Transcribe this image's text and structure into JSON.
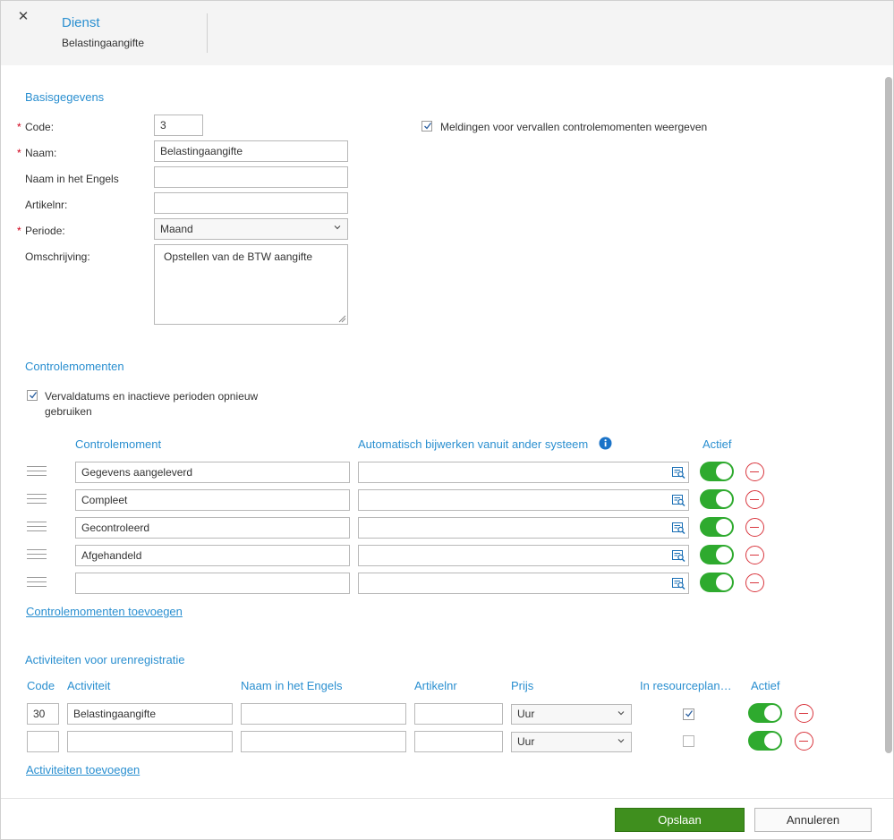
{
  "header": {
    "title": "Dienst",
    "subtitle": "Belastingaangifte",
    "close_icon": "close-icon"
  },
  "basis": {
    "section_title": "Basisgegevens",
    "code": {
      "label": "Code:",
      "value": "3",
      "required": true
    },
    "naam": {
      "label": "Naam:",
      "value": "Belastingaangifte",
      "required": true
    },
    "naam_engels": {
      "label": "Naam in het Engels",
      "value": ""
    },
    "artikelnr": {
      "label": "Artikelnr:",
      "value": ""
    },
    "periode": {
      "label": "Periode:",
      "value": "Maand",
      "required": true
    },
    "omschrijving": {
      "label": "Omschrijving:",
      "value": "Opstellen van de BTW aangifte"
    },
    "meldingen": {
      "label": "Meldingen voor vervallen controlemomenten weergeven",
      "checked": true
    }
  },
  "controle": {
    "section_title": "Controlemomenten",
    "reuse": {
      "label_line1": "Vervaldatums en inactieve perioden opnieuw",
      "label_line2": "gebruiken",
      "checked": true
    },
    "col_moment": "Controlemoment",
    "col_auto": "Automatisch bijwerken vanuit ander systeem",
    "col_actief": "Actief",
    "rows": [
      {
        "name": "Gegevens aangeleverd",
        "auto": "",
        "actief": true
      },
      {
        "name": "Compleet",
        "auto": "",
        "actief": true
      },
      {
        "name": "Gecontroleerd",
        "auto": "",
        "actief": true
      },
      {
        "name": "Afgehandeld",
        "auto": "",
        "actief": true
      },
      {
        "name": "",
        "auto": "",
        "actief": true
      }
    ],
    "add_link": "Controlemomenten toevoegen"
  },
  "activiteiten": {
    "section_title": "Activiteiten voor urenregistratie",
    "col_code": "Code",
    "col_activiteit": "Activiteit",
    "col_naam_engels": "Naam in het Engels",
    "col_artikelnr": "Artikelnr",
    "col_prijs": "Prijs",
    "col_resource": "In resourceplan…",
    "col_actief": "Actief",
    "rows": [
      {
        "code": "30",
        "activiteit": "Belastingaangifte",
        "naam_engels": "",
        "artikelnr": "",
        "prijs": "Uur",
        "resource": true,
        "actief": true
      },
      {
        "code": "",
        "activiteit": "",
        "naam_engels": "",
        "artikelnr": "",
        "prijs": "Uur",
        "resource": false,
        "actief": true
      }
    ],
    "add_link": "Activiteiten toevoegen"
  },
  "footer": {
    "save": "Opslaan",
    "cancel": "Annuleren"
  },
  "colors": {
    "accent": "#2a8fd0",
    "primary_button": "#3f8f1e",
    "toggle_on": "#2eaa2e",
    "remove": "#d9363e"
  }
}
